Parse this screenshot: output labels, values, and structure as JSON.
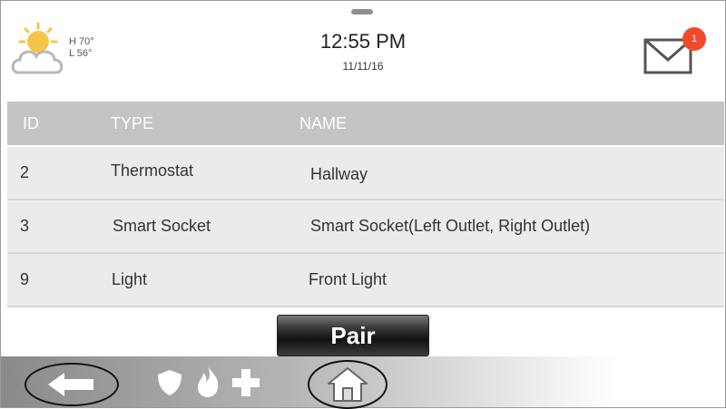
{
  "weather": {
    "high": "H 70°",
    "low": "L 56°",
    "icon": "partly-cloudy-icon"
  },
  "status": {
    "time": "12:55 PM",
    "date": "11/11/16"
  },
  "notifications": {
    "count": "1",
    "icon": "envelope-icon"
  },
  "table": {
    "headers": [
      "ID",
      "TYPE",
      "NAME"
    ],
    "rows": [
      {
        "id": "2",
        "type": "Thermostat",
        "name": "Hallway"
      },
      {
        "id": "3",
        "type": "Smart Socket",
        "name": "Smart Socket(Left Outlet, Right Outlet)"
      },
      {
        "id": "9",
        "type": "Light",
        "name": "Front Light"
      }
    ]
  },
  "actions": {
    "pair_label": "Pair"
  },
  "nav": {
    "icons": [
      "back-arrow-icon",
      "shield-icon",
      "flame-icon",
      "plus-icon",
      "home-icon"
    ],
    "accent": "#f04a2a"
  }
}
